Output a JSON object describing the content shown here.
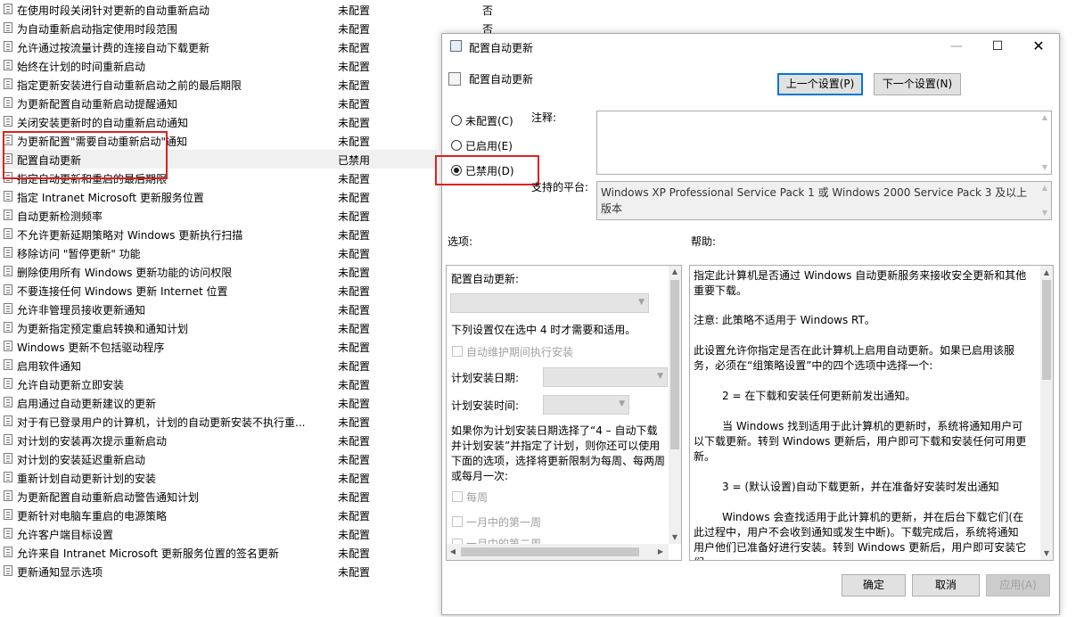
{
  "policies": [
    {
      "name": "在使用时段关闭针对更新的自动重新启动",
      "state": "未配置",
      "comment": "否"
    },
    {
      "name": "为自动重新启动指定使用时段范围",
      "state": "未配置",
      "comment": "否"
    },
    {
      "name": "允许通过按流量计费的连接自动下载更新",
      "state": "未配置",
      "comment": ""
    },
    {
      "name": "始终在计划的时间重新启动",
      "state": "未配置",
      "comment": ""
    },
    {
      "name": "指定更新安装进行自动重新启动之前的最后期限",
      "state": "未配置",
      "comment": ""
    },
    {
      "name": "为更新配置自动重新启动提醒通知",
      "state": "未配置",
      "comment": ""
    },
    {
      "name": "关闭安装更新时的自动重新启动通知",
      "state": "未配置",
      "comment": ""
    },
    {
      "name": "为更新配置\"需要自动重新启动\"通知",
      "state": "未配置",
      "comment": ""
    },
    {
      "name": "配置自动更新",
      "state": "已禁用",
      "comment": ""
    },
    {
      "name": "指定自动更新和重启的最后期限",
      "state": "未配置",
      "comment": ""
    },
    {
      "name": "指定 Intranet Microsoft 更新服务位置",
      "state": "未配置",
      "comment": ""
    },
    {
      "name": "自动更新检测频率",
      "state": "未配置",
      "comment": ""
    },
    {
      "name": "不允许更新延期策略对 Windows 更新执行扫描",
      "state": "未配置",
      "comment": ""
    },
    {
      "name": "移除访问 \"暂停更新\" 功能",
      "state": "未配置",
      "comment": ""
    },
    {
      "name": "删除使用所有 Windows 更新功能的访问权限",
      "state": "未配置",
      "comment": ""
    },
    {
      "name": "不要连接任何 Windows 更新 Internet 位置",
      "state": "未配置",
      "comment": ""
    },
    {
      "name": "允许非管理员接收更新通知",
      "state": "未配置",
      "comment": ""
    },
    {
      "name": "为更新指定预定重启转换和通知计划",
      "state": "未配置",
      "comment": ""
    },
    {
      "name": "Windows 更新不包括驱动程序",
      "state": "未配置",
      "comment": ""
    },
    {
      "name": "启用软件通知",
      "state": "未配置",
      "comment": ""
    },
    {
      "name": "允许自动更新立即安装",
      "state": "未配置",
      "comment": ""
    },
    {
      "name": "启用通过自动更新建议的更新",
      "state": "未配置",
      "comment": ""
    },
    {
      "name": "对于有已登录用户的计算机，计划的自动更新安装不执行重...",
      "state": "未配置",
      "comment": ""
    },
    {
      "name": "对计划的安装再次提示重新启动",
      "state": "未配置",
      "comment": ""
    },
    {
      "name": "对计划的安装延迟重新启动",
      "state": "未配置",
      "comment": ""
    },
    {
      "name": "重新计划自动更新计划的安装",
      "state": "未配置",
      "comment": ""
    },
    {
      "name": "为更新配置自动重新启动警告通知计划",
      "state": "未配置",
      "comment": ""
    },
    {
      "name": "更新针对电脑车重启的电源策略",
      "state": "未配置",
      "comment": ""
    },
    {
      "name": "允许客户端目标设置",
      "state": "未配置",
      "comment": ""
    },
    {
      "name": "允许来自 Intranet Microsoft 更新服务位置的签名更新",
      "state": "未配置",
      "comment": ""
    },
    {
      "name": "更新通知显示选项",
      "state": "未配置",
      "comment": ""
    }
  ],
  "dialog": {
    "window_title": "配置自动更新",
    "header_title": "配置自动更新",
    "prev_button": "上一个设置(P)",
    "next_button": "下一个设置(N)",
    "radio_not_configured": "未配置(C)",
    "radio_enabled": "已启用(E)",
    "radio_disabled": "已禁用(D)",
    "selected_radio": "disabled",
    "comment_label": "注释:",
    "comment_value": "",
    "platform_label": "支持的平台:",
    "platform_value": "Windows XP Professional Service Pack 1 或 Windows 2000 Service Pack 3 及以上版本",
    "options_label": "选项:",
    "help_label": "帮助:",
    "ok_button": "确定",
    "cancel_button": "取消",
    "apply_button": "应用(A)"
  },
  "options": {
    "configure_label": "配置自动更新:",
    "configure_value": "",
    "note": "下列设置仅在选中 4 时才需要和适用。",
    "maintenance_checkbox": "自动维护期间执行安装",
    "schedule_day_label": "计划安装日期:",
    "schedule_time_label": "计划安装时间:",
    "explain": "如果你为计划安装日期选择了“4 – 自动下载并计划安装”并指定了计划，则你还可以使用下面的选项，选择将更新限制为每周、每两周或每月一次:",
    "weekly": "每周",
    "first_week": "一月中的第一周",
    "second_week": "一月中的第二周"
  },
  "help": {
    "p1": "指定此计算机是否通过 Windows 自动更新服务来接收安全更新和其他重要下载。",
    "p2": "注意: 此策略不适用于 Windows RT。",
    "p3": "此设置允许你指定是否在此计算机上启用自动更新。如果已启用该服务，必须在“组策略设置”中的四个选项中选择一个:",
    "p4": "2 = 在下载和安装任何更新前发出通知。",
    "p5": "当 Windows 找到适用于此计算机的更新时，系统将通知用户可以下载更新。转到 Windows 更新后，用户即可下载和安装任何可用更新。",
    "p6": "3 = (默认设置)自动下载更新，并在准备好安装时发出通知",
    "p7": "Windows 会查找适用于此计算机的更新，并在后台下载它们(在此过程中，用户不会收到通知或发生中断)。下载完成后，系统将通知用户他们已准备好进行安装。转到 Windows 更新后，用户即可安装它们。"
  }
}
